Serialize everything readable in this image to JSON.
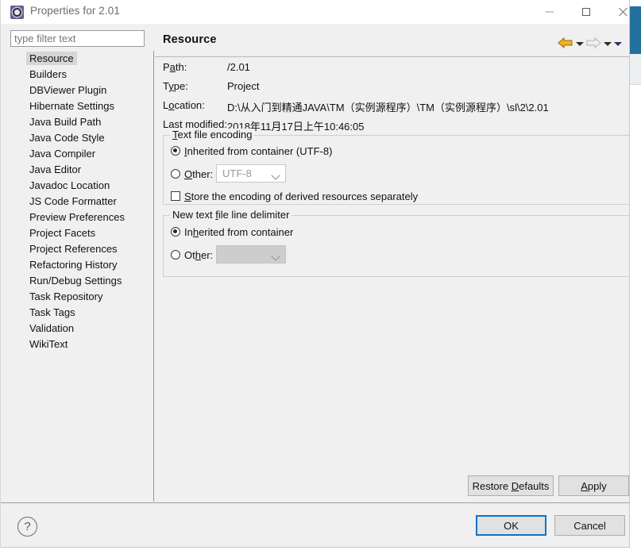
{
  "window": {
    "title": "Properties for 2.01",
    "icon": "eclipse-properties-icon",
    "minimize_label": "Minimize",
    "maximize_label": "Maximize",
    "close_label": "Close"
  },
  "filter": {
    "placeholder": "type filter text",
    "value": ""
  },
  "tree": {
    "selected": "Resource",
    "items": [
      {
        "label": "Resource"
      },
      {
        "label": "Builders"
      },
      {
        "label": "DBViewer Plugin"
      },
      {
        "label": "Hibernate Settings"
      },
      {
        "label": "Java Build Path"
      },
      {
        "label": "Java Code Style"
      },
      {
        "label": "Java Compiler"
      },
      {
        "label": "Java Editor"
      },
      {
        "label": "Javadoc Location"
      },
      {
        "label": "JS Code Formatter"
      },
      {
        "label": "Preview Preferences"
      },
      {
        "label": "Project Facets"
      },
      {
        "label": "Project References"
      },
      {
        "label": "Refactoring History"
      },
      {
        "label": "Run/Debug Settings"
      },
      {
        "label": "Task Repository"
      },
      {
        "label": "Task Tags"
      },
      {
        "label": "Validation"
      },
      {
        "label": "WikiText"
      }
    ]
  },
  "page": {
    "title": "Resource",
    "nav": {
      "back_label": "Back",
      "back_menu_label": "Back history",
      "forward_label": "Forward",
      "forward_menu_label": "Forward history",
      "view_menu_label": "View menu"
    },
    "fields": [
      {
        "label_pre": "P",
        "label_mnemonic": "a",
        "label_post": "th:",
        "label": "Path:",
        "value": "/2.01"
      },
      {
        "label_pre": "T",
        "label_mnemonic": "y",
        "label_post": "pe:",
        "label": "Type:",
        "value": "Project"
      },
      {
        "label_pre": "L",
        "label_mnemonic": "o",
        "label_post": "cation:",
        "label": "Location:",
        "value": "D:\\从入门到精通JAVA\\TM（实例源程序）\\TM（实例源程序）\\sl\\2\\2.01"
      },
      {
        "label_pre": "Last ",
        "label_mnemonic": "m",
        "label_post": "odified:",
        "label": "Last modified:",
        "value": "2018年11月17日上午10:46:05"
      }
    ],
    "encoding_group": {
      "title_pre": "",
      "title_mnemonic": "T",
      "title_post": "ext file encoding",
      "title": "Text file encoding",
      "inherited": {
        "label_pre": "",
        "label_mnemonic": "I",
        "label_post": "nherited from container (UTF-8)",
        "label": "Inherited from container (UTF-8)",
        "checked": true
      },
      "other": {
        "label_pre": "",
        "label_mnemonic": "O",
        "label_post": "ther:",
        "label": "Other:",
        "checked": false
      },
      "combo_value": "UTF-8",
      "store_checkbox": {
        "label_pre": "",
        "label_mnemonic": "S",
        "label_post": "tore the encoding of derived resources separately",
        "label": "Store the encoding of derived resources separately",
        "checked": false
      }
    },
    "delimiter_group": {
      "title_pre": "New text ",
      "title_mnemonic": "f",
      "title_post": "ile line delimiter",
      "title": "New text file line delimiter",
      "inherited": {
        "label_pre": "In",
        "label_mnemonic": "h",
        "label_post": "erited from container",
        "label": "Inherited from container",
        "checked": true
      },
      "other": {
        "label_pre": "Ot",
        "label_mnemonic": "h",
        "label_post": "er:",
        "label": "Other:",
        "checked": false
      },
      "combo_value": ""
    }
  },
  "buttons": {
    "restore_defaults": {
      "pre": "Restore ",
      "mnemonic": "D",
      "post": "efaults",
      "label": "Restore Defaults"
    },
    "apply": {
      "pre": "",
      "mnemonic": "A",
      "post": "pply",
      "label": "Apply"
    },
    "ok": "OK",
    "cancel": "Cancel",
    "help": "?"
  },
  "colors": {
    "accent_focus": "#0a74c8",
    "dialog_bg": "#f0f0f0",
    "selection": "#d6d6d6",
    "back_arrow": "#e8a317",
    "forward_arrow": "#d6d6d6",
    "bg_window_titlebar": "#22709f"
  }
}
